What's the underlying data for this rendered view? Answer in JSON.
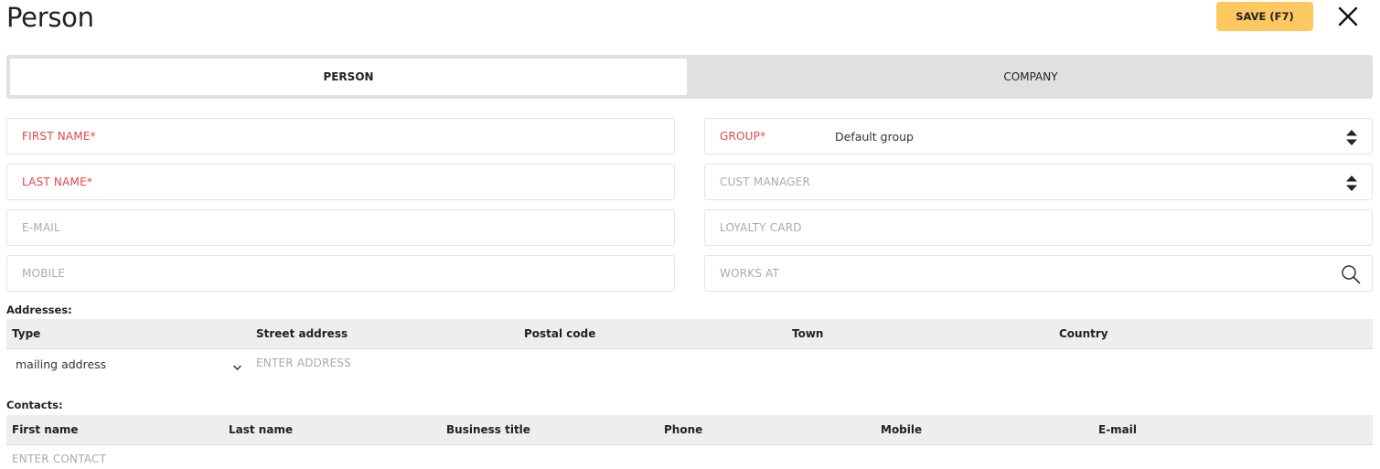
{
  "header": {
    "title": "Person",
    "save_label": "SAVE (F7)",
    "save_color": "#fdc860"
  },
  "tabs": [
    {
      "label": "PERSON",
      "active": true
    },
    {
      "label": "COMPANY",
      "active": false
    }
  ],
  "form": {
    "first_name_label": "FIRST NAME*",
    "last_name_label": "LAST NAME*",
    "email_label": "E-MAIL",
    "mobile_label": "MOBILE",
    "group_label": "GROUP*",
    "group_value": "Default group",
    "cust_manager_label": "CUST MANAGER",
    "loyalty_card_label": "LOYALTY CARD",
    "works_at_label": "WORKS AT",
    "required_color": "#e0464a"
  },
  "addresses": {
    "section_label": "Addresses:",
    "columns": [
      "Type",
      "Street address",
      "Postal code",
      "Town",
      "Country"
    ],
    "row": {
      "type_value": "mailing address",
      "street_placeholder": "ENTER ADDRESS"
    }
  },
  "contacts": {
    "section_label": "Contacts:",
    "columns": [
      "First name",
      "Last name",
      "Business title",
      "Phone",
      "Mobile",
      "E-mail"
    ],
    "placeholder": "ENTER CONTACT"
  },
  "icons": {
    "close": "close-icon",
    "sort": "sort-arrows-icon",
    "search": "search-icon",
    "chevron": "chevron-down-icon"
  }
}
